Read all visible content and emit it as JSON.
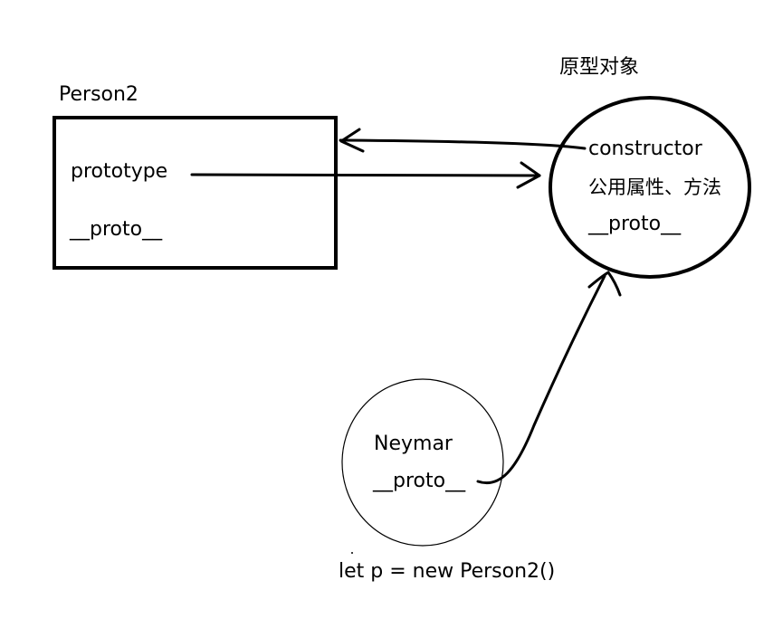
{
  "person2": {
    "title": "Person2",
    "prototype_label": "prototype",
    "proto_label": "__proto__"
  },
  "prototype_object": {
    "title": "原型对象",
    "constructor_label": "constructor",
    "members_label": "公用属性、方法",
    "proto_label": "__proto__"
  },
  "instance": {
    "name_label": "Neymar",
    "proto_label": "__proto__",
    "caption": "let p = new Person2()"
  },
  "colors": {
    "ink": "#000000",
    "background": "#ffffff"
  }
}
